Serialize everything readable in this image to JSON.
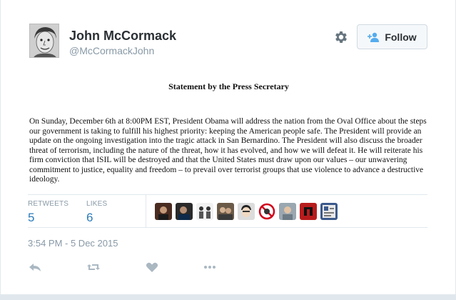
{
  "user": {
    "name": "John McCormack",
    "handle": "@McCormackJohn",
    "follow_label": "Follow"
  },
  "icons": {
    "gear": "gear-icon",
    "follow": "add-user-icon",
    "reply": "reply-icon",
    "retweet": "retweet-icon",
    "like": "heart-icon",
    "more": "more-icon"
  },
  "document": {
    "title": "Statement by the Press Secretary",
    "body": "On Sunday, December 6th at 8:00PM EST, President Obama will address the nation from the Oval Office about the steps our government is taking to fulfill his highest priority: keeping the American people safe. The President will provide an update on the ongoing investigation into the tragic attack in San Bernardino. The President will also discuss the broader threat of terrorism, including the nature of the threat, how it has evolved, and how we will defeat it. He will reiterate his firm conviction that ISIL will be destroyed and that the United States must draw upon our values – our unwavering commitment to justice, equality and freedom – to prevail over terrorist groups that use violence to advance a destructive ideology."
  },
  "stats": {
    "retweets_label": "RETWEETS",
    "retweets_value": "5",
    "likes_label": "LIKES",
    "likes_value": "6"
  },
  "tweet": {
    "timestamp": "3:54 PM - 5 Dec 2015"
  },
  "colors": {
    "link_blue": "#2b7bb9",
    "muted_gray": "#8899a6",
    "action_gray": "#aab8c2"
  }
}
